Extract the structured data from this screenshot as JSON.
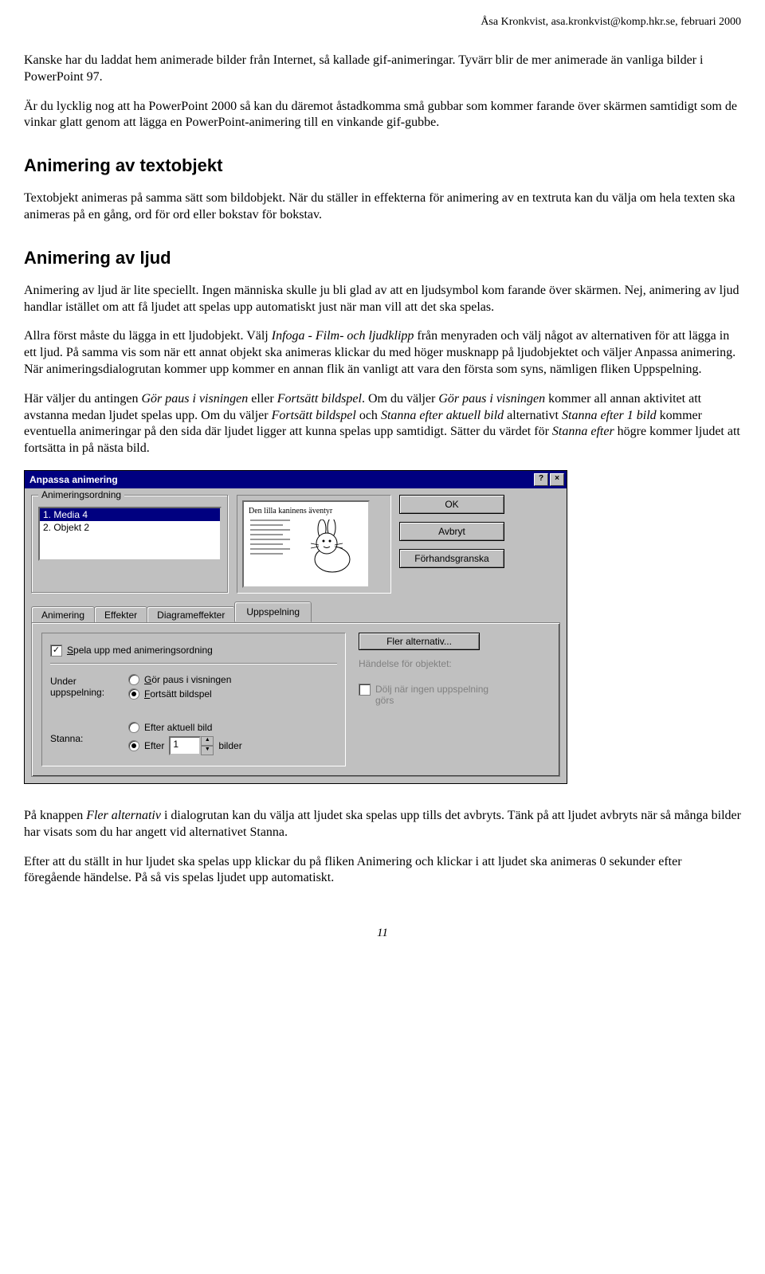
{
  "header": "Åsa Kronkvist, asa.kronkvist@komp.hkr.se, februari 2000",
  "para1": "Kanske har du laddat hem animerade bilder från Internet, så kallade gif-animeringar. Tyvärr blir de mer animerade än vanliga bilder i PowerPoint 97.",
  "para2": "Är du lycklig nog att ha PowerPoint 2000 så kan du däremot åstadkomma små gubbar som kommer farande över skärmen samtidigt som de vinkar glatt genom att lägga en PowerPoint-animering till en vinkande gif-gubbe.",
  "h_text": "Animering av textobjekt",
  "para3": "Textobjekt animeras på samma sätt som bildobjekt. När du ställer in effekterna för animering av en textruta kan du välja om hela texten ska animeras på en gång, ord för ord eller bokstav för bokstav.",
  "h_sound": "Animering av ljud",
  "para4": "Animering av ljud är lite speciellt. Ingen människa skulle ju bli glad av att en ljudsymbol kom farande över skärmen. Nej, animering av ljud handlar istället om att få ljudet att spelas upp automatiskt just när man vill att det ska spelas.",
  "para5a": "Allra först måste du lägga in ett ljudobjekt. Välj ",
  "para5b": "Infoga - Film- och ljudklipp",
  "para5c": " från menyraden och välj något av alternativen för att lägga in ett ljud. På samma vis som när ett annat objekt ska animeras klickar du med höger musknapp på ljudobjektet och väljer Anpassa animering. När animeringsdialogrutan kommer upp kommer en annan flik än vanligt att vara den första som syns, nämligen fliken Uppspelning.",
  "para6a": "Här väljer du antingen ",
  "para6b": "Gör paus i visningen",
  "para6c": " eller ",
  "para6d": "Fortsätt bildspel",
  "para6e": ". Om du väljer ",
  "para6f": "Gör paus i visningen",
  "para6g": " kommer all annan aktivitet att avstanna medan ljudet spelas upp. Om du väljer ",
  "para6h": "Fortsätt bildspel",
  "para6i": " och ",
  "para6j": "Stanna efter aktuell bild",
  "para6k": " alternativt ",
  "para6l": "Stanna efter 1 bild",
  "para6m": " kommer eventuella animeringar på den sida där ljudet ligger att kunna spelas upp samtidigt. Sätter du värdet för ",
  "para6n": "Stanna efter",
  "para6o": " högre kommer ljudet att fortsätta in på nästa bild.",
  "dialog": {
    "title": "Anpassa animering",
    "order_group": "Animeringsordning",
    "order_items": [
      "1. Media 4",
      "2. Objekt 2"
    ],
    "preview_title": "Den lilla kaninens äventyr",
    "btn_ok": "OK",
    "btn_cancel": "Avbryt",
    "btn_preview": "Förhandsgranska",
    "tabs": [
      "Animering",
      "Effekter",
      "Diagrameffekter",
      "Uppspelning"
    ],
    "chk_play": "Spela upp med animeringsordning",
    "lbl_during": "Under uppspelning:",
    "radio_pause": "Gör paus i visningen",
    "radio_continue": "Fortsätt bildspel",
    "lbl_stop": "Stanna:",
    "radio_after_current": "Efter aktuell bild",
    "radio_after": "Efter",
    "spin_value": "1",
    "lbl_slides": "bilder",
    "btn_more": "Fler alternativ...",
    "lbl_event": "Händelse för objektet:",
    "chk_hide": "Dölj när ingen uppspelning görs"
  },
  "para7a": "På knappen ",
  "para7b": "Fler alternativ",
  "para7c": " i dialogrutan kan du välja att ljudet ska spelas upp tills det avbryts. Tänk på att ljudet avbryts när så många bilder har visats som du har angett vid alternativet Stanna.",
  "para8": "Efter att du ställt in hur ljudet ska spelas upp klickar du på fliken Animering och klickar i att ljudet ska animeras 0 sekunder efter föregående händelse. På så vis spelas ljudet upp automatiskt.",
  "page_number": "11"
}
